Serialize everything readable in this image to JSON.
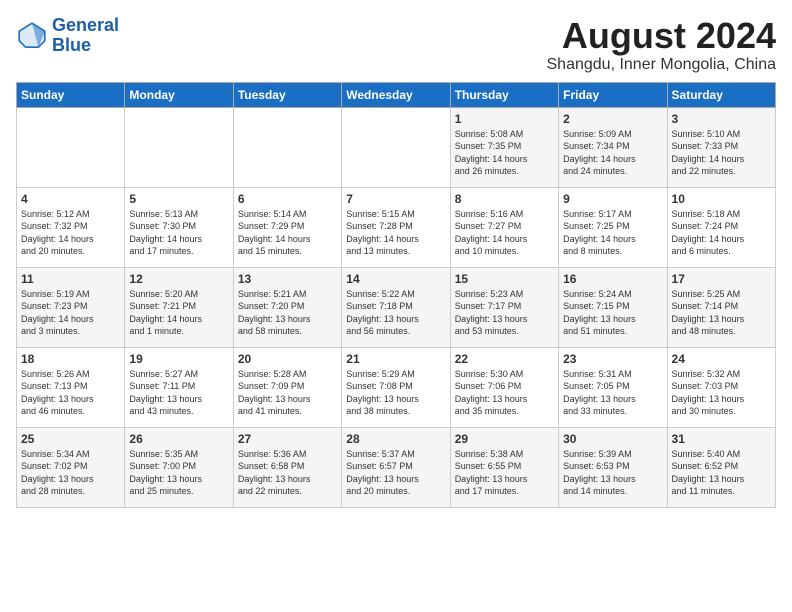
{
  "header": {
    "logo_line1": "General",
    "logo_line2": "Blue",
    "month_year": "August 2024",
    "location": "Shangdu, Inner Mongolia, China"
  },
  "weekdays": [
    "Sunday",
    "Monday",
    "Tuesday",
    "Wednesday",
    "Thursday",
    "Friday",
    "Saturday"
  ],
  "weeks": [
    [
      {
        "day": "",
        "info": ""
      },
      {
        "day": "",
        "info": ""
      },
      {
        "day": "",
        "info": ""
      },
      {
        "day": "",
        "info": ""
      },
      {
        "day": "1",
        "info": "Sunrise: 5:08 AM\nSunset: 7:35 PM\nDaylight: 14 hours\nand 26 minutes."
      },
      {
        "day": "2",
        "info": "Sunrise: 5:09 AM\nSunset: 7:34 PM\nDaylight: 14 hours\nand 24 minutes."
      },
      {
        "day": "3",
        "info": "Sunrise: 5:10 AM\nSunset: 7:33 PM\nDaylight: 14 hours\nand 22 minutes."
      }
    ],
    [
      {
        "day": "4",
        "info": "Sunrise: 5:12 AM\nSunset: 7:32 PM\nDaylight: 14 hours\nand 20 minutes."
      },
      {
        "day": "5",
        "info": "Sunrise: 5:13 AM\nSunset: 7:30 PM\nDaylight: 14 hours\nand 17 minutes."
      },
      {
        "day": "6",
        "info": "Sunrise: 5:14 AM\nSunset: 7:29 PM\nDaylight: 14 hours\nand 15 minutes."
      },
      {
        "day": "7",
        "info": "Sunrise: 5:15 AM\nSunset: 7:28 PM\nDaylight: 14 hours\nand 13 minutes."
      },
      {
        "day": "8",
        "info": "Sunrise: 5:16 AM\nSunset: 7:27 PM\nDaylight: 14 hours\nand 10 minutes."
      },
      {
        "day": "9",
        "info": "Sunrise: 5:17 AM\nSunset: 7:25 PM\nDaylight: 14 hours\nand 8 minutes."
      },
      {
        "day": "10",
        "info": "Sunrise: 5:18 AM\nSunset: 7:24 PM\nDaylight: 14 hours\nand 6 minutes."
      }
    ],
    [
      {
        "day": "11",
        "info": "Sunrise: 5:19 AM\nSunset: 7:23 PM\nDaylight: 14 hours\nand 3 minutes."
      },
      {
        "day": "12",
        "info": "Sunrise: 5:20 AM\nSunset: 7:21 PM\nDaylight: 14 hours\nand 1 minute."
      },
      {
        "day": "13",
        "info": "Sunrise: 5:21 AM\nSunset: 7:20 PM\nDaylight: 13 hours\nand 58 minutes."
      },
      {
        "day": "14",
        "info": "Sunrise: 5:22 AM\nSunset: 7:18 PM\nDaylight: 13 hours\nand 56 minutes."
      },
      {
        "day": "15",
        "info": "Sunrise: 5:23 AM\nSunset: 7:17 PM\nDaylight: 13 hours\nand 53 minutes."
      },
      {
        "day": "16",
        "info": "Sunrise: 5:24 AM\nSunset: 7:15 PM\nDaylight: 13 hours\nand 51 minutes."
      },
      {
        "day": "17",
        "info": "Sunrise: 5:25 AM\nSunset: 7:14 PM\nDaylight: 13 hours\nand 48 minutes."
      }
    ],
    [
      {
        "day": "18",
        "info": "Sunrise: 5:26 AM\nSunset: 7:13 PM\nDaylight: 13 hours\nand 46 minutes."
      },
      {
        "day": "19",
        "info": "Sunrise: 5:27 AM\nSunset: 7:11 PM\nDaylight: 13 hours\nand 43 minutes."
      },
      {
        "day": "20",
        "info": "Sunrise: 5:28 AM\nSunset: 7:09 PM\nDaylight: 13 hours\nand 41 minutes."
      },
      {
        "day": "21",
        "info": "Sunrise: 5:29 AM\nSunset: 7:08 PM\nDaylight: 13 hours\nand 38 minutes."
      },
      {
        "day": "22",
        "info": "Sunrise: 5:30 AM\nSunset: 7:06 PM\nDaylight: 13 hours\nand 35 minutes."
      },
      {
        "day": "23",
        "info": "Sunrise: 5:31 AM\nSunset: 7:05 PM\nDaylight: 13 hours\nand 33 minutes."
      },
      {
        "day": "24",
        "info": "Sunrise: 5:32 AM\nSunset: 7:03 PM\nDaylight: 13 hours\nand 30 minutes."
      }
    ],
    [
      {
        "day": "25",
        "info": "Sunrise: 5:34 AM\nSunset: 7:02 PM\nDaylight: 13 hours\nand 28 minutes."
      },
      {
        "day": "26",
        "info": "Sunrise: 5:35 AM\nSunset: 7:00 PM\nDaylight: 13 hours\nand 25 minutes."
      },
      {
        "day": "27",
        "info": "Sunrise: 5:36 AM\nSunset: 6:58 PM\nDaylight: 13 hours\nand 22 minutes."
      },
      {
        "day": "28",
        "info": "Sunrise: 5:37 AM\nSunset: 6:57 PM\nDaylight: 13 hours\nand 20 minutes."
      },
      {
        "day": "29",
        "info": "Sunrise: 5:38 AM\nSunset: 6:55 PM\nDaylight: 13 hours\nand 17 minutes."
      },
      {
        "day": "30",
        "info": "Sunrise: 5:39 AM\nSunset: 6:53 PM\nDaylight: 13 hours\nand 14 minutes."
      },
      {
        "day": "31",
        "info": "Sunrise: 5:40 AM\nSunset: 6:52 PM\nDaylight: 13 hours\nand 11 minutes."
      }
    ]
  ]
}
